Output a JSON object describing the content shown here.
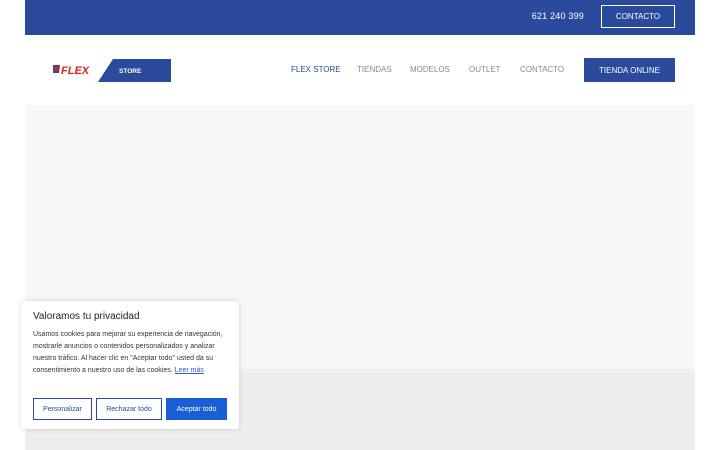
{
  "topbar": {
    "phone": "621 240 399",
    "contact_button": "CONTACTO"
  },
  "logo": {
    "brand": "FLEX",
    "store": "STORE"
  },
  "nav": {
    "items": [
      "FLEX STORE",
      "TIENDAS",
      "MODELOS",
      "OUTLET",
      "CONTACTO"
    ],
    "active": "FLEX STORE",
    "shop_button": "TIENDA ONLINE"
  },
  "cookie": {
    "title": "Valoramos tu privacidad",
    "text": "Usamos cookies para mejorar su experiencia de navegación, mostrarle anuncios o contenidos personalizados y analizar nuestro tráfico. Al hacer clic en \"Aceptar todo\" usted da su consentimiento a nuestro uso de las cookies.",
    "link": "Leer más",
    "buttons": {
      "customize": "Personalizar",
      "reject": "Rechazar todo",
      "accept": "Aceptar todo"
    }
  },
  "colors": {
    "brand_blue": "#2a4b9b",
    "accept_blue": "#1a5ed6",
    "logo_red": "#e2211c"
  }
}
